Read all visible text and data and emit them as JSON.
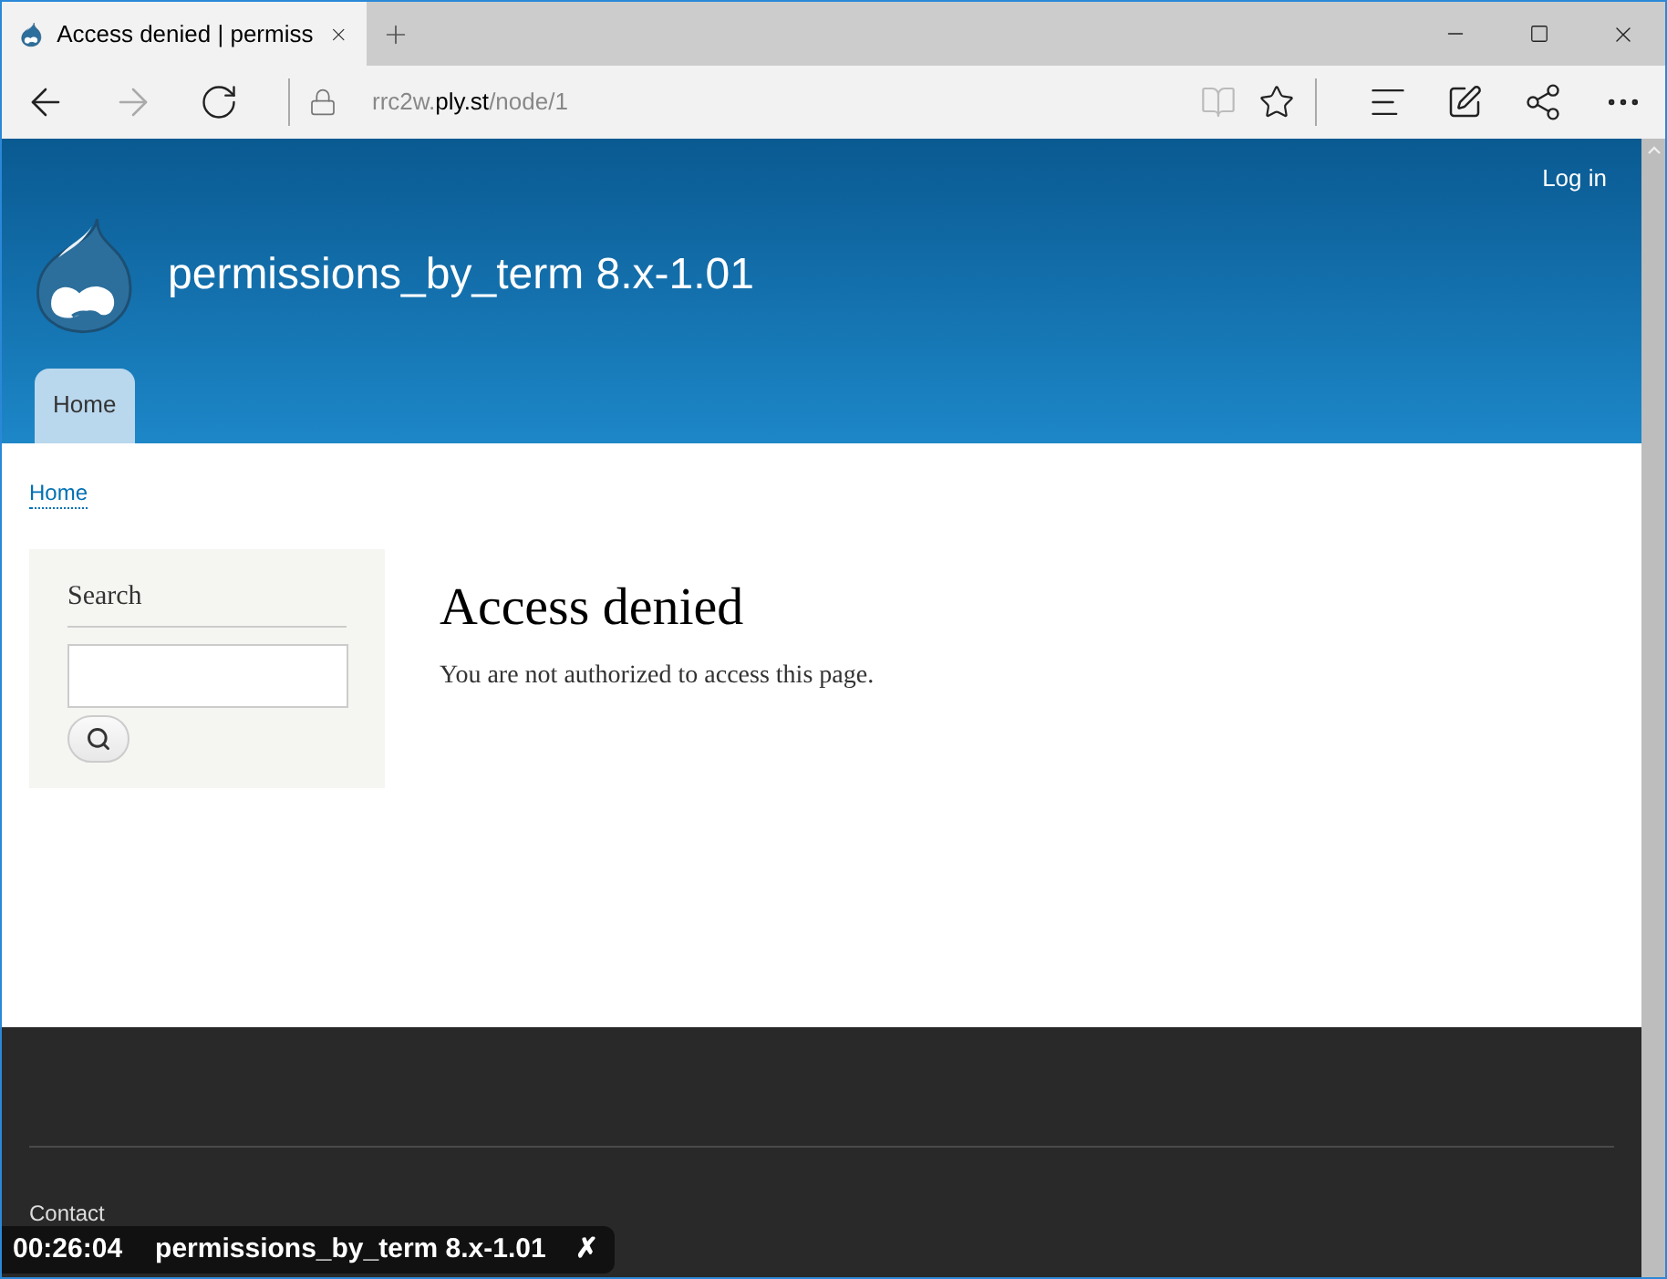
{
  "browser": {
    "tab": {
      "title": "Access denied | permiss",
      "selected": true
    },
    "address": {
      "prefix": "rrc2w.",
      "domain": "ply.st",
      "path": "/node/1"
    }
  },
  "header": {
    "login": "Log in",
    "site_name": "permissions_by_term 8.x-1.01",
    "nav": [
      {
        "label": "Home",
        "selected": true
      }
    ]
  },
  "breadcrumb": [
    "Home"
  ],
  "sidebar": {
    "title": "Search"
  },
  "main": {
    "title": "Access denied",
    "message": "You are not authorized to access this page."
  },
  "footer": {
    "links": [
      "Contact"
    ]
  },
  "overlay": {
    "time": "00:26:04",
    "title": "permissions_by_term 8.x-1.01",
    "close": "✗"
  }
}
